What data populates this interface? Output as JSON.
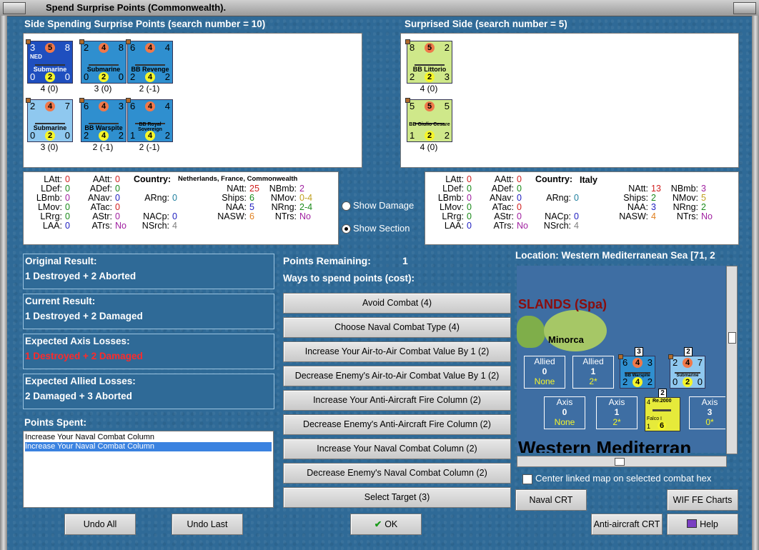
{
  "window": {
    "title": "Spend Surprise Points (Commonwealth)."
  },
  "left_side": {
    "heading": "Side Spending Surprise Points (search number = 10)",
    "units": [
      {
        "tl": "3",
        "tm": "5",
        "tr": "8",
        "tag": "NED",
        "name": "Submarine",
        "bl": "0",
        "bm": "2",
        "br": "0",
        "caption": "4 (0)",
        "bg": "#1f4fbf"
      },
      {
        "tl": "2",
        "tm": "4",
        "tr": "8",
        "tag": "",
        "name": "Submarine",
        "bl": "0",
        "bm": "2",
        "br": "0",
        "caption": "3 (0)",
        "bg": "#2f8fcf"
      },
      {
        "tl": "6",
        "tm": "4",
        "tr": "4",
        "tag": "",
        "name": "BB Revenge",
        "bl": "2",
        "bm": "4",
        "br": "2",
        "caption": "2 (-1)",
        "bg": "#2f8fcf"
      },
      {
        "tl": "2",
        "tm": "4",
        "tr": "7",
        "tag": "",
        "name": "Submarine",
        "bl": "0",
        "bm": "2",
        "br": "0",
        "caption": "3 (0)",
        "bg": "#8fc8ef"
      },
      {
        "tl": "6",
        "tm": "4",
        "tr": "3",
        "tag": "",
        "name": "BB Warspite",
        "bl": "2",
        "bm": "4",
        "br": "2",
        "caption": "2 (-1)",
        "bg": "#2f8fcf"
      },
      {
        "tl": "6",
        "tm": "4",
        "tr": "4",
        "tag": "",
        "name": "BB Royal Sovereign",
        "bl": "1",
        "bm": "4",
        "br": "2",
        "caption": "2 (-1)",
        "bg": "#2f8fcf"
      }
    ],
    "stats": {
      "latt": "0",
      "ldef": "0",
      "lbmb": "0",
      "lmov": "0",
      "lrng": "0",
      "laa": "0",
      "aatt": "0",
      "adef": "0",
      "anav": "0",
      "atac": "0",
      "astr": "0",
      "atrs": "No",
      "arng": "0",
      "nacp": "0",
      "nsrch": "4",
      "country_label": "Country:",
      "country": "Netherlands, France, Commonwealth",
      "natt": "25",
      "ships": "6",
      "naa": "5",
      "nasw": "6",
      "nbmb": "2",
      "nmov": "0-4",
      "nrng": "2-4",
      "ntrs": "No"
    }
  },
  "right_side": {
    "heading": "Surprised Side (search number = 5)",
    "units": [
      {
        "tl": "8",
        "tm": "5",
        "tr": "2",
        "name": "BB Littorio",
        "bl": "2",
        "bm": "2",
        "br": "3",
        "caption": "4 (0)"
      },
      {
        "tl": "5",
        "tm": "5",
        "tr": "5",
        "name": "BB Giulio Cesare",
        "bl": "1",
        "bm": "2",
        "br": "2",
        "caption": "4 (0)"
      }
    ],
    "stats": {
      "latt": "0",
      "ldef": "0",
      "lbmb": "0",
      "lmov": "0",
      "lrng": "0",
      "laa": "0",
      "aatt": "0",
      "adef": "0",
      "anav": "0",
      "atac": "0",
      "astr": "0",
      "atrs": "No",
      "arng": "0",
      "nacp": "0",
      "nsrch": "4",
      "country_label": "Country:",
      "country": "Italy",
      "natt": "13",
      "ships": "2",
      "naa": "3",
      "nasw": "4",
      "nbmb": "3",
      "nmov": "5",
      "nrng": "2",
      "ntrs": "No"
    }
  },
  "labels": {
    "latt": "LAtt:",
    "ldef": "LDef:",
    "lbmb": "LBmb:",
    "lmov": "LMov:",
    "lrng": "LRrg:",
    "laa": "LAA:",
    "aatt": "AAtt:",
    "adef": "ADef:",
    "anav": "ANav:",
    "atac": "ATac:",
    "astr": "AStr:",
    "atrs": "ATrs:",
    "arng": "ARng:",
    "nacp": "NACp:",
    "nsrch": "NSrch:",
    "natt": "NAtt:",
    "ships": "Ships:",
    "naa": "NAA:",
    "nasw": "NASW:",
    "nbmb": "NBmb:",
    "nmov": "NMov:",
    "nrng": "NRng:",
    "ntrs": "NTrs:"
  },
  "toggles": {
    "show_damage": "Show Damage",
    "show_section": "Show Section"
  },
  "results": {
    "original_label": "Original Result:",
    "original": "1 Destroyed + 2 Aborted",
    "current_label": "Current Result:",
    "current": "1 Destroyed + 2 Damaged",
    "axis_label": "Expected Axis Losses:",
    "axis": "1 Destroyed + 2 Damaged",
    "allied_label": "Expected Allied Losses:",
    "allied": "2 Damaged + 3 Aborted",
    "axis_color": "#ff2a2a"
  },
  "points_spent": {
    "label": "Points Spent:",
    "items": [
      "Increase Your Naval Combat Column",
      "Increase Your Naval Combat Column"
    ]
  },
  "spend": {
    "remaining_label": "Points Remaining:",
    "remaining": "1",
    "ways_label": "Ways to spend points (cost):",
    "options": [
      "Avoid Combat (4)",
      "Choose Naval Combat Type (4)",
      "Increase Your Air-to-Air Combat Value By 1 (2)",
      "Decrease Enemy's Air-to-Air Combat Value By 1 (2)",
      "Increase Your Anti-Aircraft Fire Column (2)",
      "Decrease Enemy's Anti-Aircraft Fire Column (2)",
      "Increase Your Naval Combat Column (2)",
      "Decrease Enemy's Naval Combat Column (2)",
      "Select Target (3)"
    ]
  },
  "map": {
    "location": "Location: Western Mediterranean Sea [71, 2",
    "islands": "SLANDS (Spa)",
    "minorca": "Minorca",
    "sea": "Western Mediterran",
    "allied_boxes": [
      {
        "title": "Allied",
        "n": "0",
        "sub": "None"
      },
      {
        "title": "Allied",
        "n": "1",
        "sub": "2*"
      }
    ],
    "axis_boxes": [
      {
        "title": "Axis",
        "n": "0",
        "sub": "None"
      },
      {
        "title": "Axis",
        "n": "1",
        "sub": "2*"
      },
      {
        "title": "Axis",
        "n": "3",
        "sub": "0*"
      }
    ],
    "stack_counts": [
      "3",
      "2",
      "2"
    ],
    "map_units": [
      {
        "tl": "6",
        "tm": "4",
        "tr": "3",
        "name": "BB Warspite",
        "bl": "2",
        "bm": "4",
        "br": "2"
      },
      {
        "tl": "2",
        "tm": "4",
        "tr": "7",
        "name": "Submarine",
        "bl": "0",
        "bm": "2",
        "br": "0"
      }
    ],
    "air_unit": {
      "tl": "4",
      "name": "Re.2000",
      "sub": "Falco I",
      "bl": "1",
      "bm": "6"
    },
    "center_linked": "Center linked map on selected combat hex"
  },
  "buttons": {
    "naval_crt": "Naval CRT",
    "wif_charts": "WIF FE Charts",
    "aa_crt": "Anti-aircraft CRT",
    "help": "Help",
    "undo_all": "Undo All",
    "undo_last": "Undo Last",
    "ok": "OK"
  }
}
